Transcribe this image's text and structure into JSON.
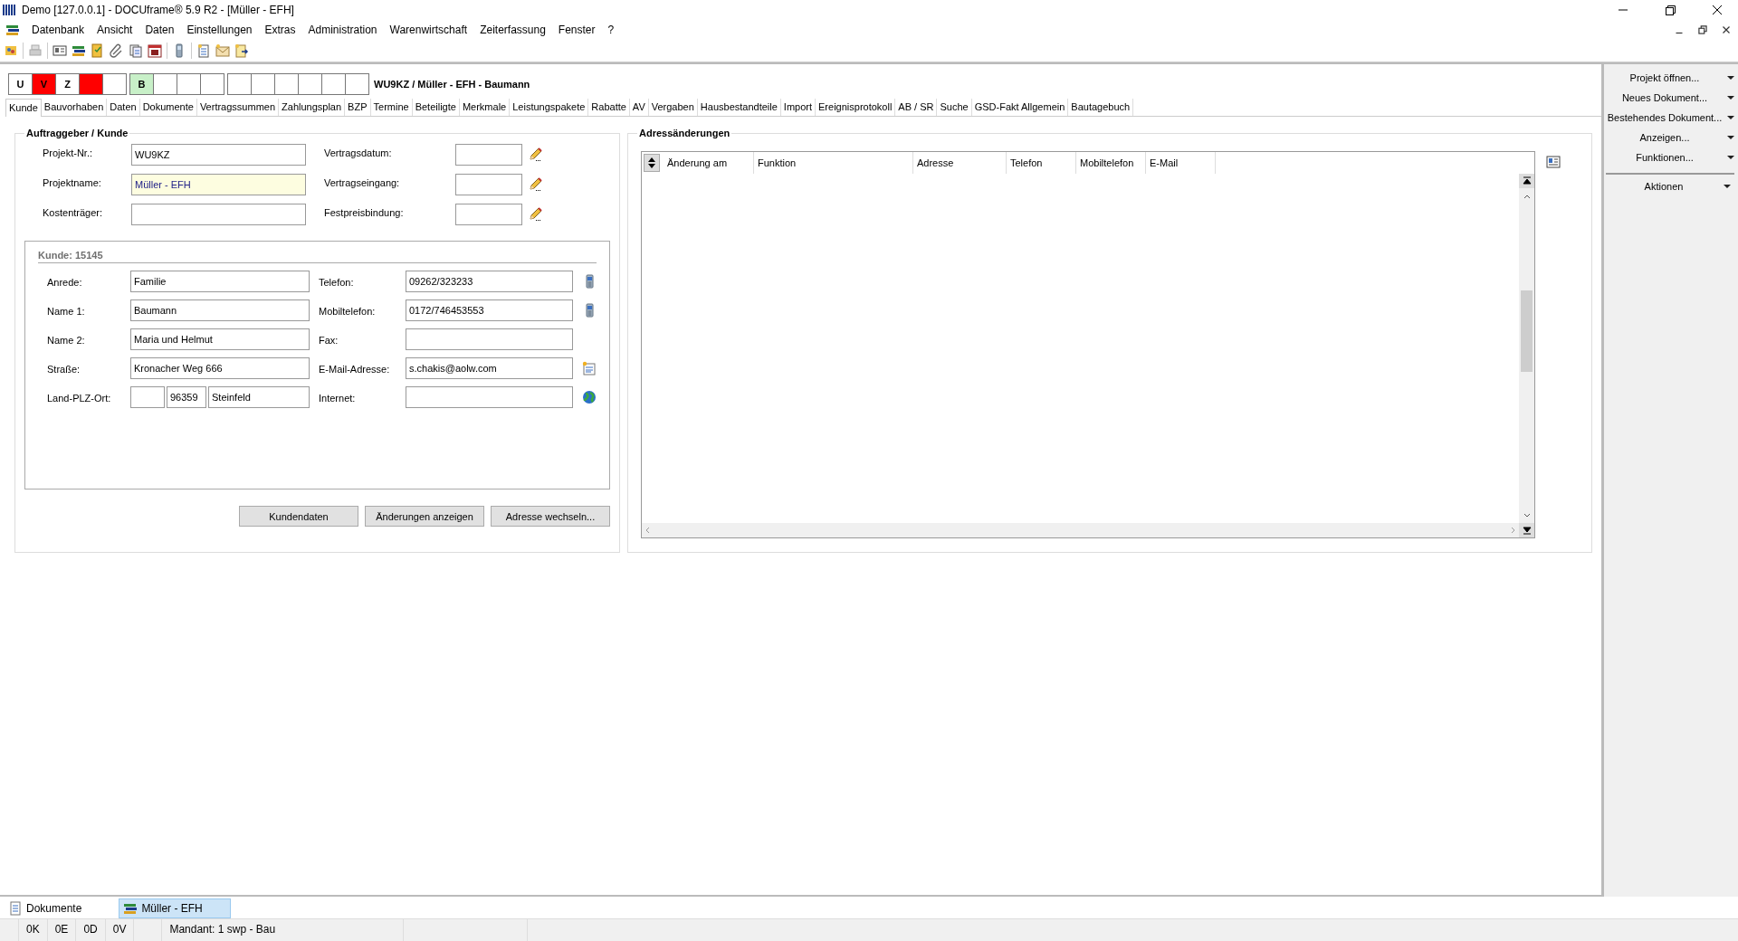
{
  "window": {
    "title": "Demo [127.0.0.1] - DOCUframe® 5.9 R2 - [Müller - EFH]"
  },
  "menu": [
    "Datenbank",
    "Ansicht",
    "Daten",
    "Einstellungen",
    "Extras",
    "Administration",
    "Warenwirtschaft",
    "Zeiterfassung",
    "Fenster",
    "?"
  ],
  "status_boxes": [
    [
      {
        "label": "U",
        "color": "#ffffff"
      },
      {
        "label": "V",
        "color": "#ff0000"
      },
      {
        "label": "Z",
        "color": "#ffffff"
      },
      {
        "color": "#ff0000"
      },
      {
        "color": "#ffffff"
      }
    ],
    [
      {
        "label": "B",
        "color": "#c8f0c8"
      },
      {
        "color": "#ffffff"
      },
      {
        "color": "#ffffff"
      },
      {
        "color": "#ffffff"
      }
    ],
    [
      {
        "color": "#ffffff"
      },
      {
        "color": "#ffffff"
      },
      {
        "color": "#ffffff"
      },
      {
        "color": "#ffffff"
      },
      {
        "color": "#ffffff"
      },
      {
        "color": "#ffffff"
      }
    ]
  ],
  "project_heading": "WU9KZ / Müller - EFH - Baumann",
  "tabs": [
    {
      "label": "Kunde",
      "selected": true
    },
    {
      "label": "Bauvorhaben",
      "selected": false
    },
    {
      "label": "Daten",
      "selected": false
    },
    {
      "label": "Dokumente",
      "selected": false
    },
    {
      "label": "Vertragssummen",
      "selected": false
    },
    {
      "label": "Zahlungsplan",
      "selected": false
    },
    {
      "label": "BZP",
      "selected": false
    },
    {
      "label": "Termine",
      "selected": false
    },
    {
      "label": "Beteiligte",
      "selected": false
    },
    {
      "label": "Merkmale",
      "selected": false
    },
    {
      "label": "Leistungspakete",
      "selected": false
    },
    {
      "label": "Rabatte",
      "selected": false
    },
    {
      "label": "AV",
      "selected": false
    },
    {
      "label": "Vergaben",
      "selected": false
    },
    {
      "label": "Hausbestandteile",
      "selected": false
    },
    {
      "label": "Import",
      "selected": false
    },
    {
      "label": "Ereignisprotokoll",
      "selected": false
    },
    {
      "label": "AB / SR",
      "selected": false
    },
    {
      "label": "Suche",
      "selected": false
    },
    {
      "label": "GSD-Fakt Allgemein",
      "selected": false
    },
    {
      "label": "Bautagebuch",
      "selected": false
    }
  ],
  "client_section": {
    "title": "Auftraggeber / Kunde",
    "fields": [
      {
        "label": "Projekt-Nr.:",
        "value": "WU9KZ",
        "highlighted": false
      },
      {
        "label": "Projektname:",
        "value": "Müller - EFH",
        "highlighted": true
      },
      {
        "label": "Kostenträger:",
        "highlighted": false
      }
    ],
    "date_fields": [
      {
        "label": "Vertragsdatum:"
      },
      {
        "label": "Vertragseingang:"
      },
      {
        "label": "Festpreisbindung:"
      }
    ],
    "customer": {
      "title": "Kunde: 15145",
      "left": [
        {
          "kind": "text",
          "label": "Anrede:",
          "value": "Familie"
        },
        {
          "kind": "text",
          "label": "Name 1:",
          "value": "Baumann"
        },
        {
          "kind": "text",
          "label": "Name 2:",
          "value": "Maria und Helmut"
        },
        {
          "kind": "text",
          "label": "Straße:",
          "value": "Kronacher Weg 666"
        },
        {
          "kind": "address",
          "label": "Land-PLZ-Ort:",
          "plz": "96359",
          "ort": "Steinfeld"
        }
      ],
      "right": [
        {
          "kind": "phone",
          "label": "Telefon:",
          "value": "09262/323233"
        },
        {
          "kind": "phone",
          "label": "Mobiltelefon:",
          "value": "0172/746453553"
        },
        {
          "kind": "plain",
          "label": "Fax:"
        },
        {
          "kind": "mail",
          "label": "E-Mail-Adresse:",
          "value": "s.chakis@aolw.com"
        },
        {
          "kind": "web",
          "label": "Internet:"
        }
      ]
    },
    "buttons": [
      "Kundendaten",
      "Änderungen anzeigen",
      "Adresse wechseln..."
    ]
  },
  "address_changes": {
    "title": "Adressänderungen",
    "columns": [
      "Änderung am",
      "Funktion",
      "Adresse",
      "Telefon",
      "Mobiltelefon",
      "E-Mail"
    ]
  },
  "sidebar": {
    "groups": [
      [
        "Projekt öffnen...",
        "Neues Dokument...",
        "Bestehendes Dokument...",
        "Anzeigen...",
        "Funktionen..."
      ],
      [
        "Aktionen"
      ]
    ]
  },
  "document_tabs": [
    {
      "label": "Dokumente",
      "kind": "documents",
      "selected": false
    },
    {
      "label": "Müller - EFH",
      "kind": "project",
      "selected": true
    }
  ],
  "status_bar": [
    "0K",
    "0E",
    "0D",
    "0V",
    "Mandant: 1 swp - Bau"
  ]
}
